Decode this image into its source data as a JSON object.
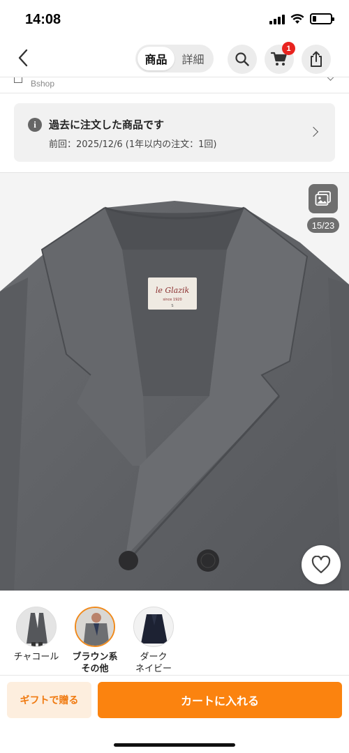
{
  "status_bar": {
    "time": "14:08",
    "icons": [
      "signal-icon",
      "wifi-icon",
      "battery-icon"
    ],
    "battery_level": 0.2
  },
  "nav": {
    "back_icon": "chevron-left-icon",
    "tabs": [
      {
        "label": "商品",
        "active": true
      },
      {
        "label": "詳細",
        "active": false
      }
    ],
    "search_icon": "search-icon",
    "cart_icon": "cart-icon",
    "cart_badge": "1",
    "share_icon": "share-icon"
  },
  "shop": {
    "name": "Bshop"
  },
  "order_notice": {
    "title": "過去に注文した商品です",
    "subtitle": "前回：2025/12/6 (1年以内の注文：1回)"
  },
  "gallery": {
    "counter": "15/23",
    "label_logo": "le Glazik",
    "label_sub": "since 1920",
    "label_size": "S"
  },
  "variants": [
    {
      "label": "チャコール",
      "selected": false
    },
    {
      "label": "ブラウン系\nその他",
      "selected": true
    },
    {
      "label": "ダーク\nネイビー",
      "selected": false
    }
  ],
  "actions": {
    "gift_label": "ギフトで贈る",
    "cart_label": "カートに入れる"
  },
  "colors": {
    "accent": "#fb830f",
    "badge": "#e8231f",
    "coat_gray": "#5f6165"
  }
}
